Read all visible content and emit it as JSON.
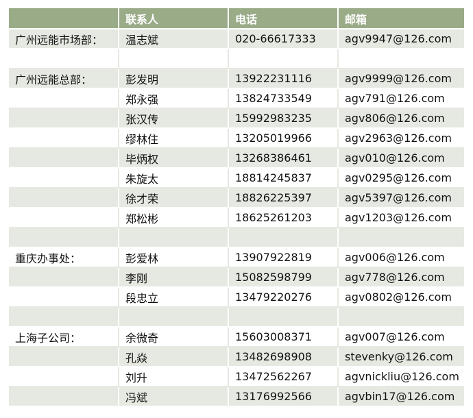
{
  "table": {
    "headers": [
      "",
      "联系人",
      "电话",
      "邮箱"
    ],
    "rows": [
      {
        "dept": "广州远能市场部：",
        "name": "温志斌",
        "phone": "020-66617333",
        "email": "agv9947@126.com",
        "shade": true
      },
      {
        "dept": "",
        "name": "",
        "phone": "",
        "email": "",
        "shade": false
      },
      {
        "dept": "广州远能总部：",
        "name": "彭发明",
        "phone": "13922231116",
        "email": "agv9999@126.com",
        "shade": true
      },
      {
        "dept": "",
        "name": "郑永强",
        "phone": "13824733549",
        "email": "agv791@126.com",
        "shade": false
      },
      {
        "dept": "",
        "name": "张汉传",
        "phone": "15992983235",
        "email": "agv806@126.com",
        "shade": true
      },
      {
        "dept": "",
        "name": "缪林住",
        "phone": "13205019966",
        "email": "agv2963@126.com",
        "shade": false
      },
      {
        "dept": "",
        "name": "毕炳权",
        "phone": "13268386461",
        "email": "agv010@126.com",
        "shade": true
      },
      {
        "dept": "",
        "name": "朱旋太",
        "phone": "18814245837",
        "email": "agv0295@126.com",
        "shade": false
      },
      {
        "dept": "",
        "name": "徐才荣",
        "phone": "18826225397",
        "email": "agv5397@126.com",
        "shade": true
      },
      {
        "dept": "",
        "name": "郑松彬",
        "phone": "18625261203",
        "email": "agv1203@126.com",
        "shade": false
      },
      {
        "dept": "",
        "name": "",
        "phone": "",
        "email": "",
        "shade": true
      },
      {
        "dept": "重庆办事处：",
        "name": "彭爱林",
        "phone": "13907922819",
        "email": "agv006@126.com",
        "shade": false
      },
      {
        "dept": "",
        "name": "李刚",
        "phone": "15082598799",
        "email": "agv778@126.com",
        "shade": true
      },
      {
        "dept": "",
        "name": "段忠立",
        "phone": "13479220276",
        "email": "agv0802@126.com",
        "shade": false
      },
      {
        "dept": "",
        "name": "",
        "phone": "",
        "email": "",
        "shade": true
      },
      {
        "dept": "上海子公司：",
        "name": "余微奇",
        "phone": "15603008371",
        "email": "agv007@126.com",
        "shade": false
      },
      {
        "dept": "",
        "name": "孔焱",
        "phone": "13482698908",
        "email": "stevenky@126.com",
        "shade": true
      },
      {
        "dept": "",
        "name": "刘升",
        "phone": "13472562267",
        "email": "agvnickliu@126.com",
        "shade": false
      },
      {
        "dept": "",
        "name": "冯斌",
        "phone": "13176992566",
        "email": "agvbin17@126.com",
        "shade": true
      }
    ]
  }
}
